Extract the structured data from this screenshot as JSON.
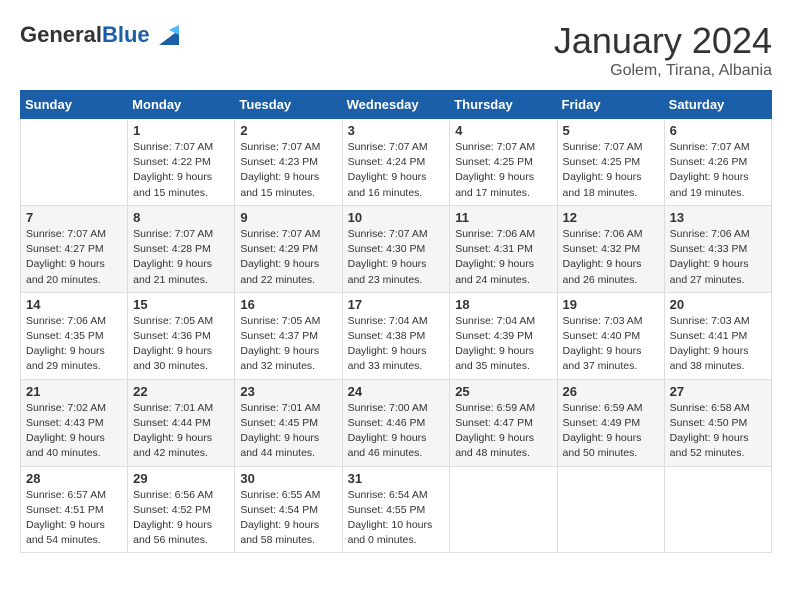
{
  "header": {
    "logo_general": "General",
    "logo_blue": "Blue",
    "month_title": "January 2024",
    "location": "Golem, Tirana, Albania"
  },
  "days_of_week": [
    "Sunday",
    "Monday",
    "Tuesday",
    "Wednesday",
    "Thursday",
    "Friday",
    "Saturday"
  ],
  "weeks": [
    [
      {
        "day": "",
        "info": ""
      },
      {
        "day": "1",
        "info": "Sunrise: 7:07 AM\nSunset: 4:22 PM\nDaylight: 9 hours\nand 15 minutes."
      },
      {
        "day": "2",
        "info": "Sunrise: 7:07 AM\nSunset: 4:23 PM\nDaylight: 9 hours\nand 15 minutes."
      },
      {
        "day": "3",
        "info": "Sunrise: 7:07 AM\nSunset: 4:24 PM\nDaylight: 9 hours\nand 16 minutes."
      },
      {
        "day": "4",
        "info": "Sunrise: 7:07 AM\nSunset: 4:25 PM\nDaylight: 9 hours\nand 17 minutes."
      },
      {
        "day": "5",
        "info": "Sunrise: 7:07 AM\nSunset: 4:25 PM\nDaylight: 9 hours\nand 18 minutes."
      },
      {
        "day": "6",
        "info": "Sunrise: 7:07 AM\nSunset: 4:26 PM\nDaylight: 9 hours\nand 19 minutes."
      }
    ],
    [
      {
        "day": "7",
        "info": "Sunrise: 7:07 AM\nSunset: 4:27 PM\nDaylight: 9 hours\nand 20 minutes."
      },
      {
        "day": "8",
        "info": "Sunrise: 7:07 AM\nSunset: 4:28 PM\nDaylight: 9 hours\nand 21 minutes."
      },
      {
        "day": "9",
        "info": "Sunrise: 7:07 AM\nSunset: 4:29 PM\nDaylight: 9 hours\nand 22 minutes."
      },
      {
        "day": "10",
        "info": "Sunrise: 7:07 AM\nSunset: 4:30 PM\nDaylight: 9 hours\nand 23 minutes."
      },
      {
        "day": "11",
        "info": "Sunrise: 7:06 AM\nSunset: 4:31 PM\nDaylight: 9 hours\nand 24 minutes."
      },
      {
        "day": "12",
        "info": "Sunrise: 7:06 AM\nSunset: 4:32 PM\nDaylight: 9 hours\nand 26 minutes."
      },
      {
        "day": "13",
        "info": "Sunrise: 7:06 AM\nSunset: 4:33 PM\nDaylight: 9 hours\nand 27 minutes."
      }
    ],
    [
      {
        "day": "14",
        "info": "Sunrise: 7:06 AM\nSunset: 4:35 PM\nDaylight: 9 hours\nand 29 minutes."
      },
      {
        "day": "15",
        "info": "Sunrise: 7:05 AM\nSunset: 4:36 PM\nDaylight: 9 hours\nand 30 minutes."
      },
      {
        "day": "16",
        "info": "Sunrise: 7:05 AM\nSunset: 4:37 PM\nDaylight: 9 hours\nand 32 minutes."
      },
      {
        "day": "17",
        "info": "Sunrise: 7:04 AM\nSunset: 4:38 PM\nDaylight: 9 hours\nand 33 minutes."
      },
      {
        "day": "18",
        "info": "Sunrise: 7:04 AM\nSunset: 4:39 PM\nDaylight: 9 hours\nand 35 minutes."
      },
      {
        "day": "19",
        "info": "Sunrise: 7:03 AM\nSunset: 4:40 PM\nDaylight: 9 hours\nand 37 minutes."
      },
      {
        "day": "20",
        "info": "Sunrise: 7:03 AM\nSunset: 4:41 PM\nDaylight: 9 hours\nand 38 minutes."
      }
    ],
    [
      {
        "day": "21",
        "info": "Sunrise: 7:02 AM\nSunset: 4:43 PM\nDaylight: 9 hours\nand 40 minutes."
      },
      {
        "day": "22",
        "info": "Sunrise: 7:01 AM\nSunset: 4:44 PM\nDaylight: 9 hours\nand 42 minutes."
      },
      {
        "day": "23",
        "info": "Sunrise: 7:01 AM\nSunset: 4:45 PM\nDaylight: 9 hours\nand 44 minutes."
      },
      {
        "day": "24",
        "info": "Sunrise: 7:00 AM\nSunset: 4:46 PM\nDaylight: 9 hours\nand 46 minutes."
      },
      {
        "day": "25",
        "info": "Sunrise: 6:59 AM\nSunset: 4:47 PM\nDaylight: 9 hours\nand 48 minutes."
      },
      {
        "day": "26",
        "info": "Sunrise: 6:59 AM\nSunset: 4:49 PM\nDaylight: 9 hours\nand 50 minutes."
      },
      {
        "day": "27",
        "info": "Sunrise: 6:58 AM\nSunset: 4:50 PM\nDaylight: 9 hours\nand 52 minutes."
      }
    ],
    [
      {
        "day": "28",
        "info": "Sunrise: 6:57 AM\nSunset: 4:51 PM\nDaylight: 9 hours\nand 54 minutes."
      },
      {
        "day": "29",
        "info": "Sunrise: 6:56 AM\nSunset: 4:52 PM\nDaylight: 9 hours\nand 56 minutes."
      },
      {
        "day": "30",
        "info": "Sunrise: 6:55 AM\nSunset: 4:54 PM\nDaylight: 9 hours\nand 58 minutes."
      },
      {
        "day": "31",
        "info": "Sunrise: 6:54 AM\nSunset: 4:55 PM\nDaylight: 10 hours\nand 0 minutes."
      },
      {
        "day": "",
        "info": ""
      },
      {
        "day": "",
        "info": ""
      },
      {
        "day": "",
        "info": ""
      }
    ]
  ]
}
